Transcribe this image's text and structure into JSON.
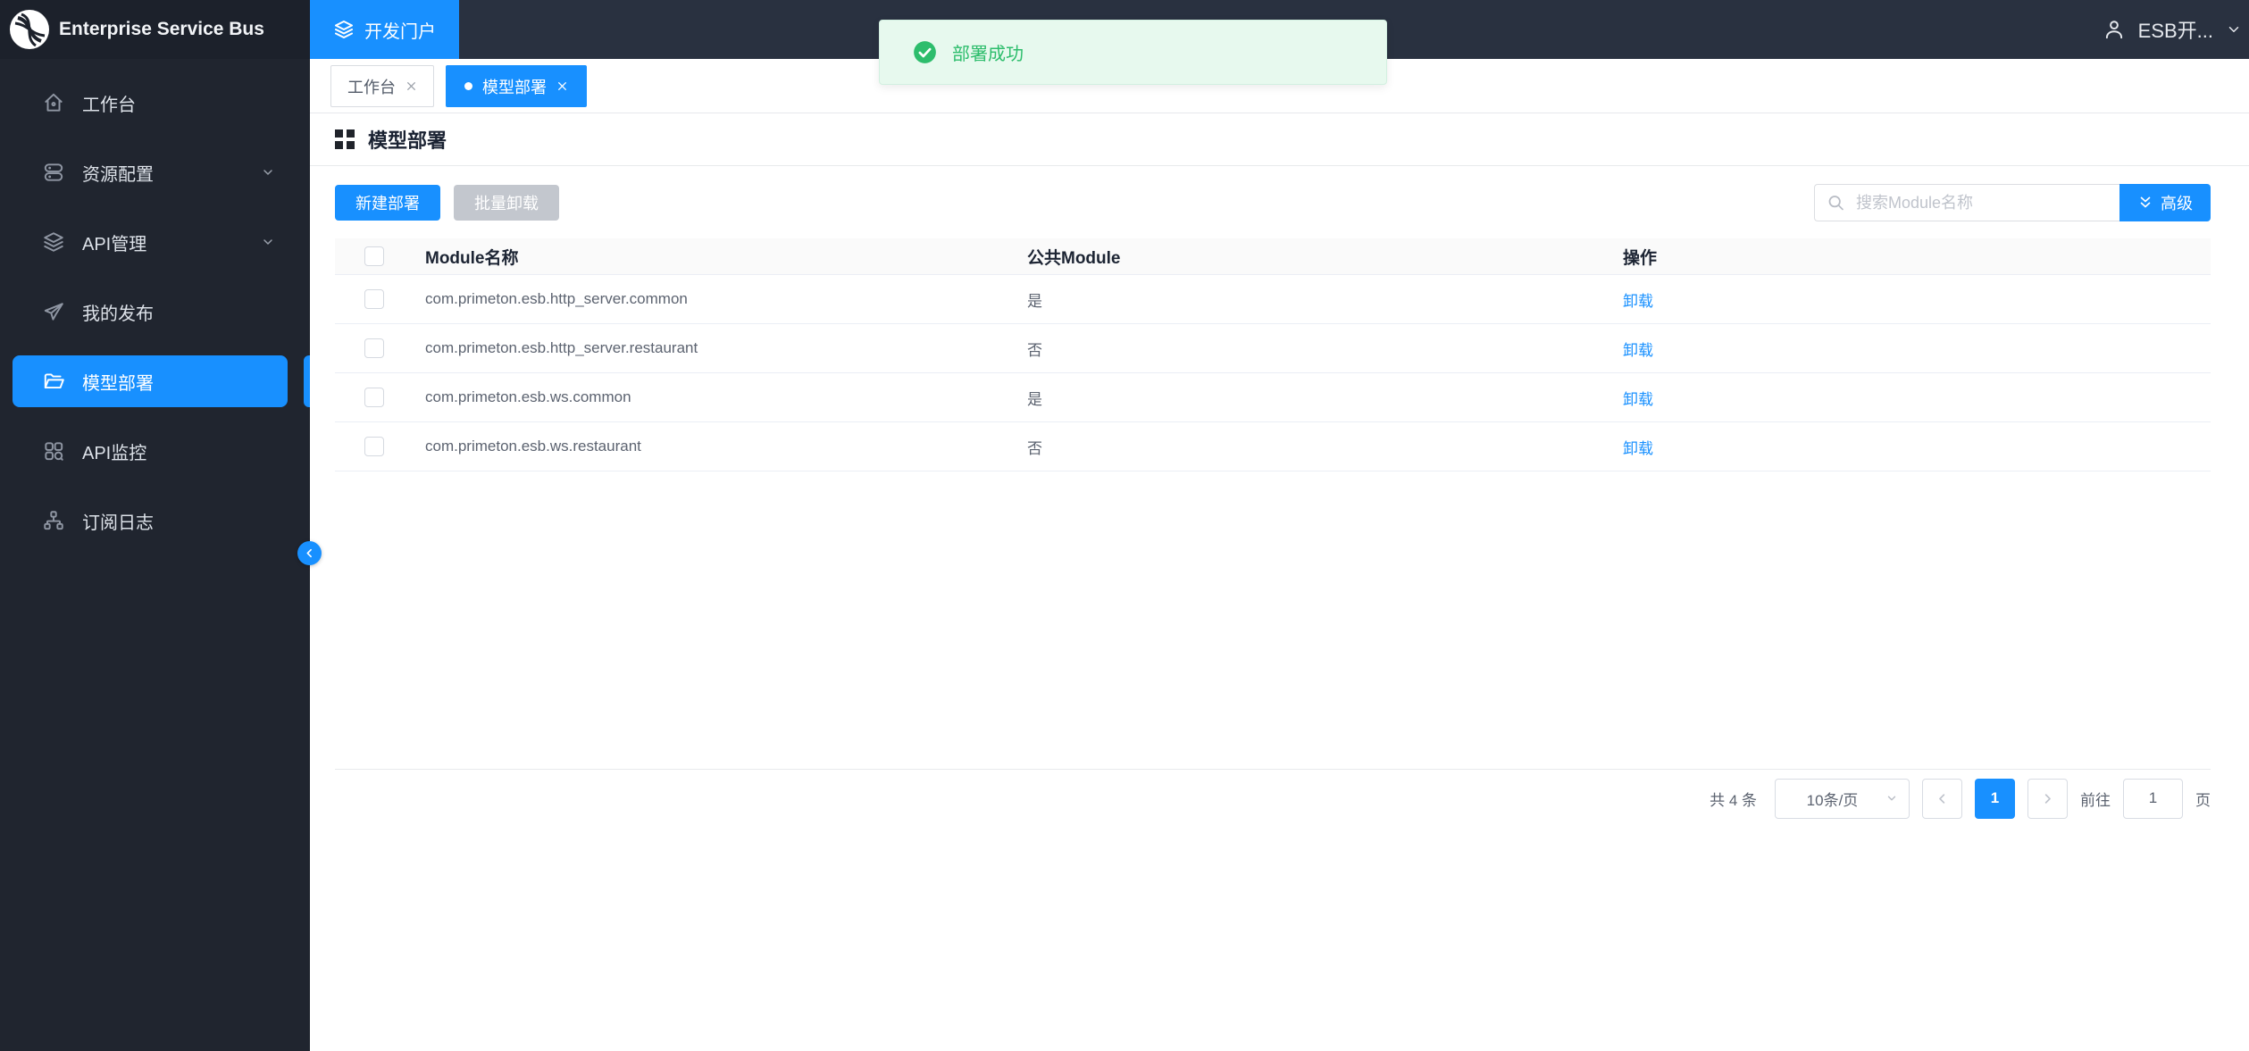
{
  "header": {
    "brand": "Enterprise Service Bus",
    "portal_tab_label": "开发门户",
    "username": "ESB开..."
  },
  "toast": {
    "message": "部署成功"
  },
  "sidebar": {
    "items": [
      {
        "label": "工作台",
        "icon": "home-icon",
        "active": false,
        "expandable": false
      },
      {
        "label": "资源配置",
        "icon": "resources-icon",
        "active": false,
        "expandable": true
      },
      {
        "label": "API管理",
        "icon": "layers-icon",
        "active": false,
        "expandable": true
      },
      {
        "label": "我的发布",
        "icon": "send-icon",
        "active": false,
        "expandable": false
      },
      {
        "label": "模型部署",
        "icon": "folder-icon",
        "active": true,
        "expandable": false
      },
      {
        "label": "API监控",
        "icon": "grid-icon",
        "active": false,
        "expandable": false
      },
      {
        "label": "订阅日志",
        "icon": "org-chart-icon",
        "active": false,
        "expandable": false
      }
    ]
  },
  "tabs": [
    {
      "label": "工作台",
      "active": false
    },
    {
      "label": "模型部署",
      "active": true
    }
  ],
  "page": {
    "title": "模型部署"
  },
  "toolbar": {
    "new_deploy_label": "新建部署",
    "batch_unload_label": "批量卸载",
    "search_placeholder": "搜索Module名称",
    "advanced_label": "高级"
  },
  "table": {
    "columns": [
      "Module名称",
      "公共Module",
      "操作"
    ],
    "rows": [
      {
        "name": "com.primeton.esb.http_server.common",
        "public": "是",
        "action": "卸载"
      },
      {
        "name": "com.primeton.esb.http_server.restaurant",
        "public": "否",
        "action": "卸载"
      },
      {
        "name": "com.primeton.esb.ws.common",
        "public": "是",
        "action": "卸载"
      },
      {
        "name": "com.primeton.esb.ws.restaurant",
        "public": "否",
        "action": "卸载"
      }
    ]
  },
  "pagination": {
    "total_label": "共 4 条",
    "page_size_label": "10条/页",
    "current_page": "1",
    "goto_label": "前往",
    "goto_value": "1",
    "page_unit_label": "页"
  },
  "colors": {
    "accent": "#1890ff",
    "success": "#2dbd6c",
    "sidebar_bg": "#20252f",
    "header_bg": "#293140",
    "toast_bg": "#e7f9ee",
    "disabled_button_bg": "#c3c7ce"
  }
}
